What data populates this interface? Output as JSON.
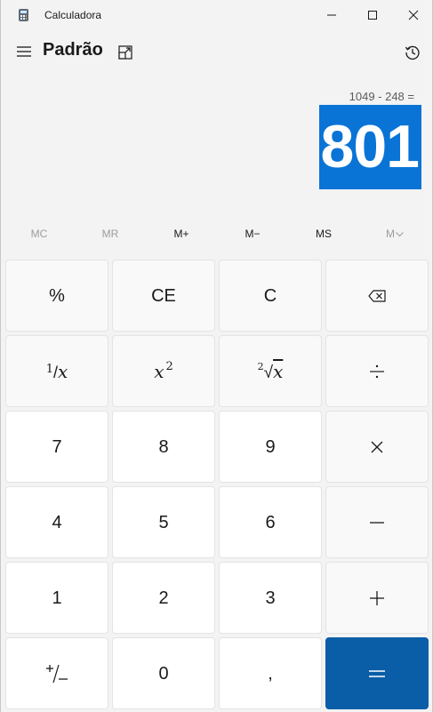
{
  "window": {
    "title": "Calculadora"
  },
  "header": {
    "mode": "Padrão"
  },
  "display": {
    "expression": "1049 - 248 =",
    "result": "801"
  },
  "memory": {
    "mc": "MC",
    "mr": "MR",
    "m_plus": "M+",
    "m_minus": "M−",
    "ms": "MS",
    "m_list": "M"
  },
  "keys": {
    "percent": "%",
    "ce": "CE",
    "c": "C",
    "seven": "7",
    "eight": "8",
    "nine": "9",
    "four": "4",
    "five": "5",
    "six": "6",
    "one": "1",
    "two": "2",
    "three": "3",
    "zero": "0",
    "decimal": ",",
    "reciprocal_num": "1",
    "reciprocal_den": "x",
    "square_base": "x",
    "square_exp": "2",
    "root_index": "2",
    "root_x": "x"
  },
  "icons": {
    "app": "calculator-icon",
    "minimize": "minimize-icon",
    "maximize": "maximize-icon",
    "close": "close-icon",
    "menu": "hamburger-menu-icon",
    "keep_on_top": "keep-on-top-icon",
    "history": "history-icon",
    "backspace": "backspace-icon",
    "divide": "divide-icon",
    "multiply": "multiply-icon",
    "subtract": "minus-icon",
    "add": "plus-icon",
    "equals": "equals-icon",
    "negate": "negate-icon",
    "memory_chevron": "chevron-down-icon"
  },
  "colors": {
    "background": "#f3f3f3",
    "result_highlight": "#0a74d6",
    "equals_key": "#0a5ea8",
    "disabled_text": "#9c9c9c"
  }
}
